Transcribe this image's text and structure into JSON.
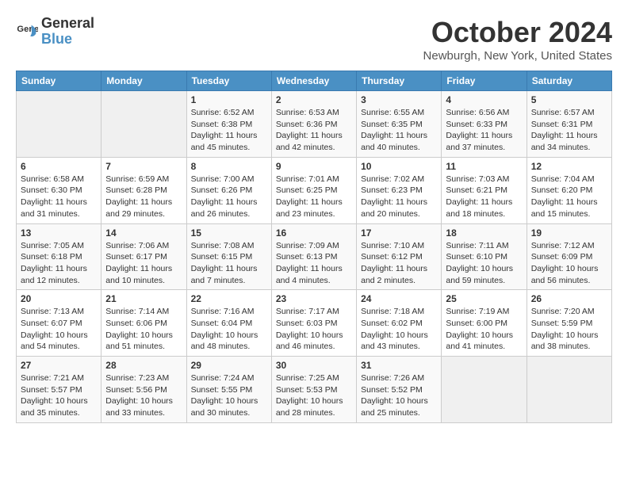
{
  "logo": {
    "text_general": "General",
    "text_blue": "Blue"
  },
  "header": {
    "month": "October 2024",
    "location": "Newburgh, New York, United States"
  },
  "days_of_week": [
    "Sunday",
    "Monday",
    "Tuesday",
    "Wednesday",
    "Thursday",
    "Friday",
    "Saturday"
  ],
  "weeks": [
    [
      {
        "day": "",
        "info": ""
      },
      {
        "day": "",
        "info": ""
      },
      {
        "day": "1",
        "info": "Sunrise: 6:52 AM\nSunset: 6:38 PM\nDaylight: 11 hours and 45 minutes."
      },
      {
        "day": "2",
        "info": "Sunrise: 6:53 AM\nSunset: 6:36 PM\nDaylight: 11 hours and 42 minutes."
      },
      {
        "day": "3",
        "info": "Sunrise: 6:55 AM\nSunset: 6:35 PM\nDaylight: 11 hours and 40 minutes."
      },
      {
        "day": "4",
        "info": "Sunrise: 6:56 AM\nSunset: 6:33 PM\nDaylight: 11 hours and 37 minutes."
      },
      {
        "day": "5",
        "info": "Sunrise: 6:57 AM\nSunset: 6:31 PM\nDaylight: 11 hours and 34 minutes."
      }
    ],
    [
      {
        "day": "6",
        "info": "Sunrise: 6:58 AM\nSunset: 6:30 PM\nDaylight: 11 hours and 31 minutes."
      },
      {
        "day": "7",
        "info": "Sunrise: 6:59 AM\nSunset: 6:28 PM\nDaylight: 11 hours and 29 minutes."
      },
      {
        "day": "8",
        "info": "Sunrise: 7:00 AM\nSunset: 6:26 PM\nDaylight: 11 hours and 26 minutes."
      },
      {
        "day": "9",
        "info": "Sunrise: 7:01 AM\nSunset: 6:25 PM\nDaylight: 11 hours and 23 minutes."
      },
      {
        "day": "10",
        "info": "Sunrise: 7:02 AM\nSunset: 6:23 PM\nDaylight: 11 hours and 20 minutes."
      },
      {
        "day": "11",
        "info": "Sunrise: 7:03 AM\nSunset: 6:21 PM\nDaylight: 11 hours and 18 minutes."
      },
      {
        "day": "12",
        "info": "Sunrise: 7:04 AM\nSunset: 6:20 PM\nDaylight: 11 hours and 15 minutes."
      }
    ],
    [
      {
        "day": "13",
        "info": "Sunrise: 7:05 AM\nSunset: 6:18 PM\nDaylight: 11 hours and 12 minutes."
      },
      {
        "day": "14",
        "info": "Sunrise: 7:06 AM\nSunset: 6:17 PM\nDaylight: 11 hours and 10 minutes."
      },
      {
        "day": "15",
        "info": "Sunrise: 7:08 AM\nSunset: 6:15 PM\nDaylight: 11 hours and 7 minutes."
      },
      {
        "day": "16",
        "info": "Sunrise: 7:09 AM\nSunset: 6:13 PM\nDaylight: 11 hours and 4 minutes."
      },
      {
        "day": "17",
        "info": "Sunrise: 7:10 AM\nSunset: 6:12 PM\nDaylight: 11 hours and 2 minutes."
      },
      {
        "day": "18",
        "info": "Sunrise: 7:11 AM\nSunset: 6:10 PM\nDaylight: 10 hours and 59 minutes."
      },
      {
        "day": "19",
        "info": "Sunrise: 7:12 AM\nSunset: 6:09 PM\nDaylight: 10 hours and 56 minutes."
      }
    ],
    [
      {
        "day": "20",
        "info": "Sunrise: 7:13 AM\nSunset: 6:07 PM\nDaylight: 10 hours and 54 minutes."
      },
      {
        "day": "21",
        "info": "Sunrise: 7:14 AM\nSunset: 6:06 PM\nDaylight: 10 hours and 51 minutes."
      },
      {
        "day": "22",
        "info": "Sunrise: 7:16 AM\nSunset: 6:04 PM\nDaylight: 10 hours and 48 minutes."
      },
      {
        "day": "23",
        "info": "Sunrise: 7:17 AM\nSunset: 6:03 PM\nDaylight: 10 hours and 46 minutes."
      },
      {
        "day": "24",
        "info": "Sunrise: 7:18 AM\nSunset: 6:02 PM\nDaylight: 10 hours and 43 minutes."
      },
      {
        "day": "25",
        "info": "Sunrise: 7:19 AM\nSunset: 6:00 PM\nDaylight: 10 hours and 41 minutes."
      },
      {
        "day": "26",
        "info": "Sunrise: 7:20 AM\nSunset: 5:59 PM\nDaylight: 10 hours and 38 minutes."
      }
    ],
    [
      {
        "day": "27",
        "info": "Sunrise: 7:21 AM\nSunset: 5:57 PM\nDaylight: 10 hours and 35 minutes."
      },
      {
        "day": "28",
        "info": "Sunrise: 7:23 AM\nSunset: 5:56 PM\nDaylight: 10 hours and 33 minutes."
      },
      {
        "day": "29",
        "info": "Sunrise: 7:24 AM\nSunset: 5:55 PM\nDaylight: 10 hours and 30 minutes."
      },
      {
        "day": "30",
        "info": "Sunrise: 7:25 AM\nSunset: 5:53 PM\nDaylight: 10 hours and 28 minutes."
      },
      {
        "day": "31",
        "info": "Sunrise: 7:26 AM\nSunset: 5:52 PM\nDaylight: 10 hours and 25 minutes."
      },
      {
        "day": "",
        "info": ""
      },
      {
        "day": "",
        "info": ""
      }
    ]
  ]
}
